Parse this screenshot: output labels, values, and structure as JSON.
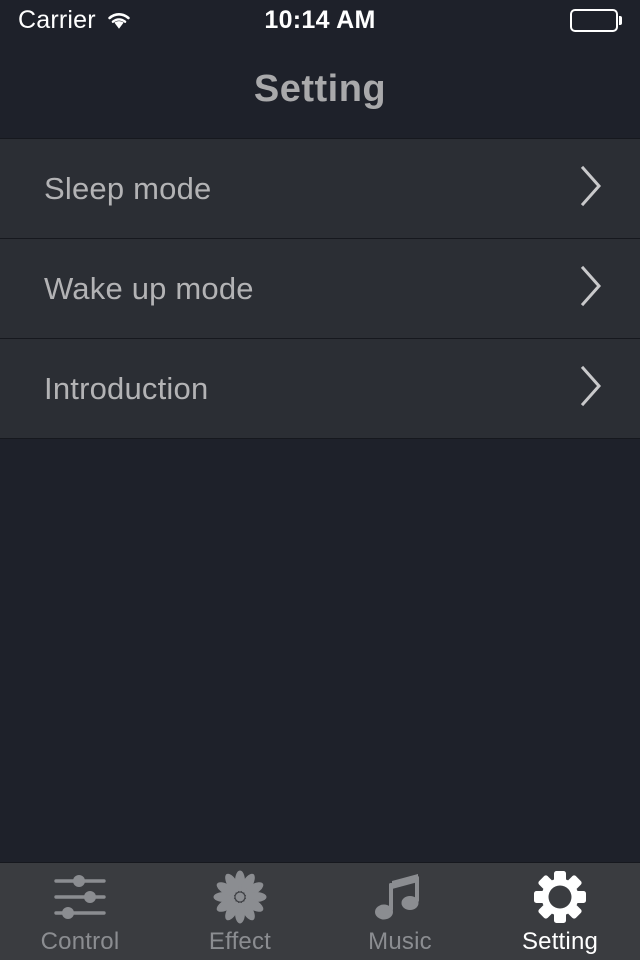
{
  "statusbar": {
    "carrier": "Carrier",
    "wifi_icon": "wifi-icon",
    "time": "10:14 AM",
    "battery_icon": "battery-full-icon"
  },
  "navbar": {
    "title": "Setting"
  },
  "list": {
    "rows": [
      {
        "label": "Sleep mode",
        "chevron_icon": "chevron-right-icon"
      },
      {
        "label": "Wake up mode",
        "chevron_icon": "chevron-right-icon"
      },
      {
        "label": "Introduction",
        "chevron_icon": "chevron-right-icon"
      }
    ]
  },
  "tabbar": {
    "tabs": [
      {
        "label": "Control",
        "icon": "sliders-icon",
        "active": false
      },
      {
        "label": "Effect",
        "icon": "flower-burst-icon",
        "active": false
      },
      {
        "label": "Music",
        "icon": "music-note-icon",
        "active": false
      },
      {
        "label": "Setting",
        "icon": "gear-icon",
        "active": true
      }
    ]
  },
  "colors": {
    "page_background": "#1e212a",
    "row_background": "#2b2e34",
    "tabbar_background": "#3a3c40",
    "separator": "#16181e",
    "title_text": "#a9a9ab",
    "row_text": "#b3b3b5",
    "tab_inactive": "#8b8d91",
    "tab_active": "#ffffff",
    "status_text": "#ffffff"
  }
}
